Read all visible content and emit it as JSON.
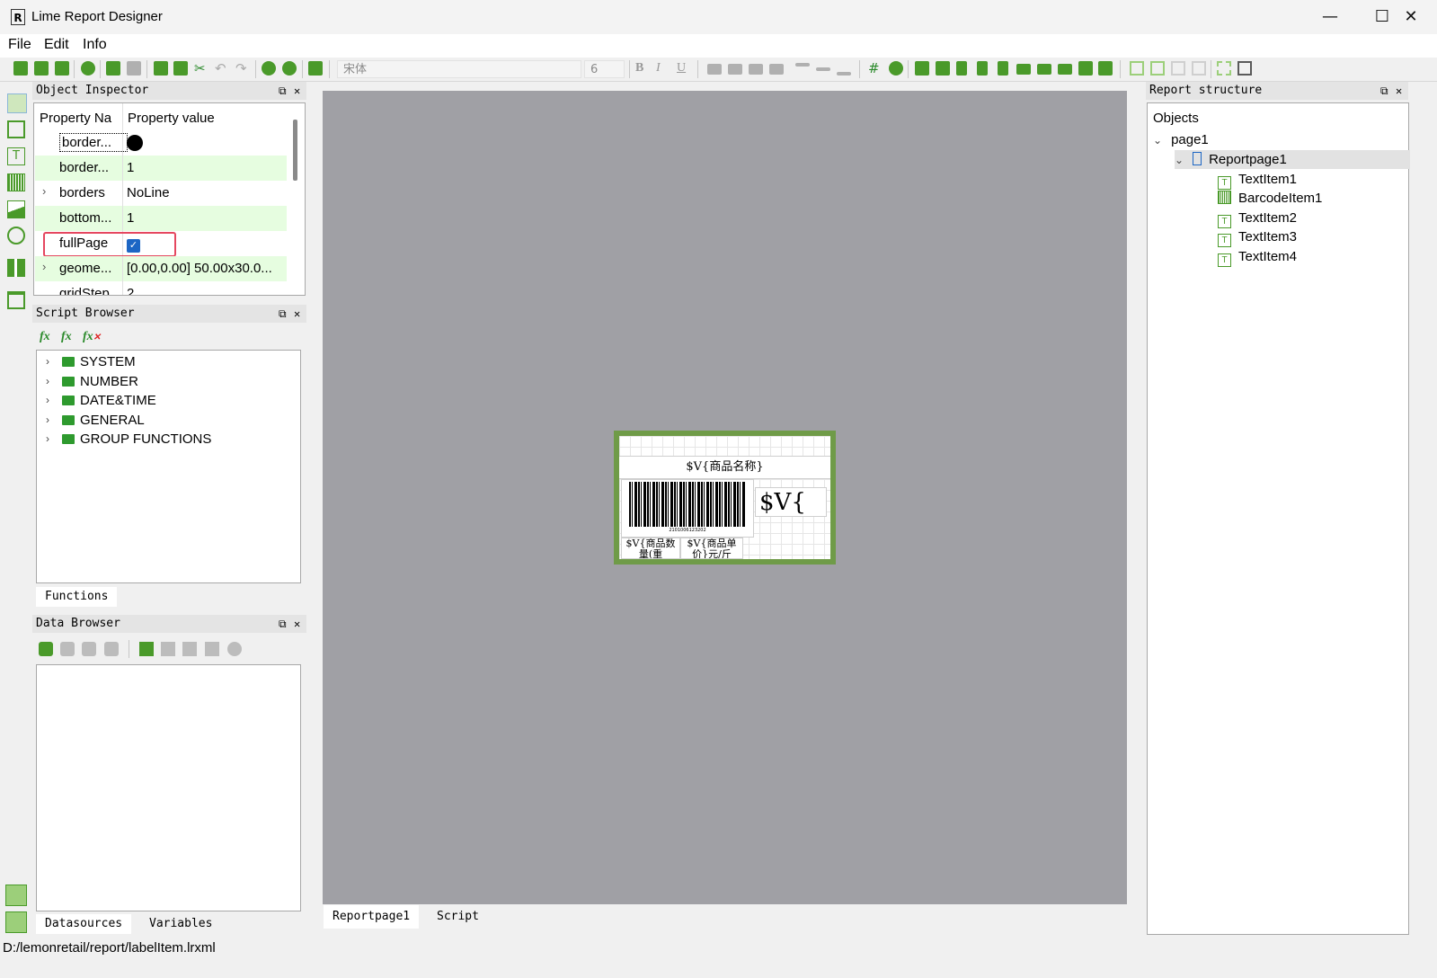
{
  "window": {
    "title": "Lime Report Designer"
  },
  "menu": {
    "items": [
      "File",
      "Edit",
      "Info"
    ]
  },
  "toolbar": {
    "font_name": "宋体",
    "font_size": "6",
    "bold": "B",
    "italic": "I",
    "underline": "U"
  },
  "object_inspector": {
    "title": "Object Inspector",
    "col_name": "Property Na",
    "col_value": "Property value",
    "rows": [
      {
        "name": "border...",
        "value": ""
      },
      {
        "name": "border...",
        "value": "1"
      },
      {
        "name": "borders",
        "value": "NoLine"
      },
      {
        "name": "bottom...",
        "value": "1"
      },
      {
        "name": "fullPage",
        "value": ""
      },
      {
        "name": "geome...",
        "value": "[0.00,0.00] 50.00x30.0..."
      },
      {
        "name": "gridStep",
        "value": "2"
      }
    ],
    "fullPage_checked": true
  },
  "script_browser": {
    "title": "Script Browser",
    "items": [
      "SYSTEM",
      "NUMBER",
      "DATE&TIME",
      "GENERAL",
      "GROUP FUNCTIONS"
    ],
    "tab": "Functions"
  },
  "data_browser": {
    "title": "Data Browser",
    "tabs": [
      "Datasources",
      "Variables"
    ]
  },
  "canvas": {
    "tabs": [
      "Reportpage1",
      "Script"
    ],
    "label": {
      "text_name": "$V{商品名称}",
      "text_qty": "$V{商品数量(重",
      "text_price": "$V{商品单价}元/斤",
      "text_big": "$V{",
      "barcode_number": "2101006123202"
    }
  },
  "report_structure": {
    "title": "Report structure",
    "root": "Objects",
    "page": "page1",
    "reportpage": "Reportpage1",
    "items": [
      "TextItem1",
      "BarcodeItem1",
      "TextItem2",
      "TextItem3",
      "TextItem4"
    ]
  },
  "status": {
    "path": "D:/lemonretail/report/labelItem.lrxml"
  }
}
